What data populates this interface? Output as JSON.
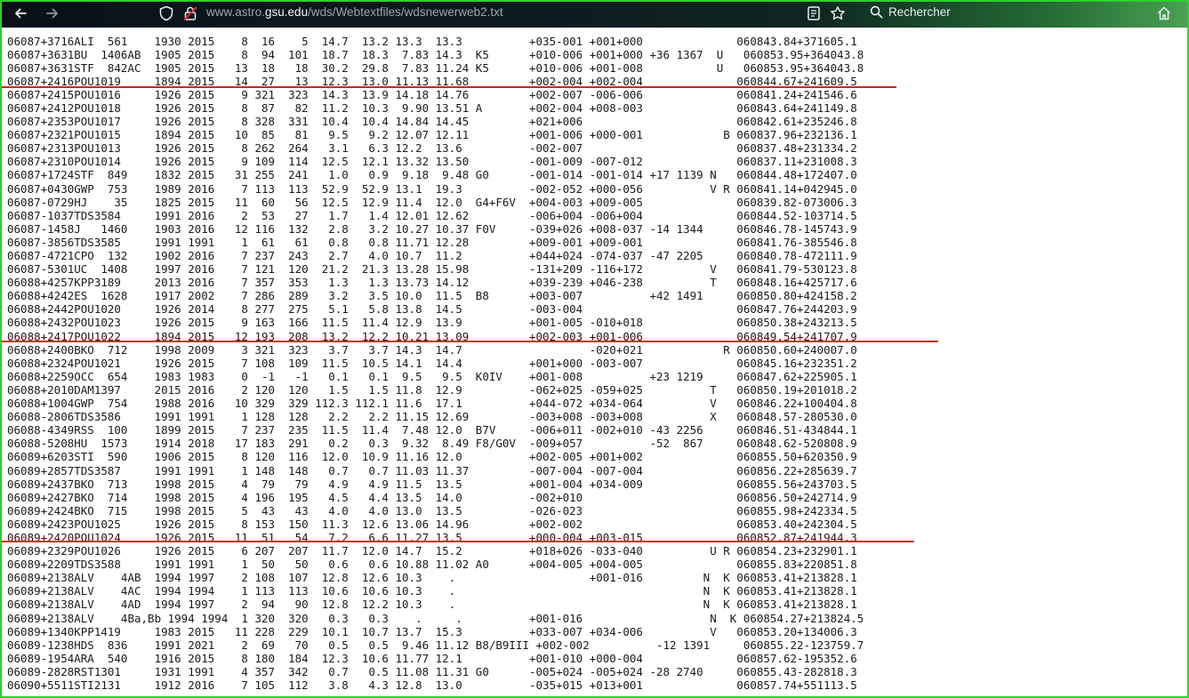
{
  "browser": {
    "url_prefix": "www.astro.",
    "url_host": "gsu.edu",
    "url_path": "/wds/Webtextfiles/wdsnewerweb2.txt",
    "search_label": "Rechercher",
    "accent_border": "#2fcf2f"
  },
  "icons": [
    "back-arrow-icon",
    "forward-arrow-icon",
    "shield-icon",
    "lock-icon",
    "reader-view-icon",
    "bookmark-star-icon",
    "search-icon",
    "home-icon"
  ],
  "separator_color": "#d62222",
  "lines": [
    "06087+3716ALI  561    1930 2015    8  16    5  14.7  13.2 13.3  13.3          +035-001 +001+000              060843.84+371605.1",
    "06087+3631BU  1406AB  1905 2015    8  94  101  18.7  18.3  7.83 14.3  K5      +010-006 +001+000 +36 1367  U   060853.95+364043.8",
    "06087+3631STF  842AC  1905 2015   13  18   18  30.2  29.8  7.83 11.24 K5      +010-006 +001-008           U   060853.95+364043.8",
    "06087+2416POU1019     1894 2015   14  27   13  12.3  13.0 11.13 11.68         +002-004 +002-004              060844.67+241609.5",
    "06087+2415POU1016     1926 2015    9 321  323  14.3  13.9 14.18 14.76         +002-007 -006-006              060841.24+241546.6",
    "06087+2412POU1018     1926 2015    8  87   82  11.2  10.3  9.90 13.51 A       +002-004 +008-003              060843.64+241149.8",
    "06087+2353POU1017     1926 2015    8 328  331  10.4  10.4 14.84 14.45         +021+006                       060842.61+235246.8",
    "06087+2321POU1015     1894 2015   10  85   81   9.5   9.2 12.07 12.11         +001-006 +000-001            B 060837.96+232136.1",
    "06087+2313POU1013     1926 2015    8 262  264   3.1   6.3 12.2  13.6          -002-007                       060837.48+231334.2",
    "06087+2310POU1014     1926 2015    9 109  114  12.5  12.1 13.32 13.50         -001-009 -007-012              060837.11+231008.3",
    "06087+1724STF  849    1832 2015   31 255  241   1.0   0.9  9.18  9.48 G0      -001-014 -001-014 +17 1139 N   060844.48+172407.0",
    "06087+0430GWP  753    1989 2016    7 113  113  52.9  52.9 13.1  19.3          -002-052 +000-056          V R 060841.14+042945.0",
    "06087-0729HJ    35    1825 2015   11  60   56  12.5  12.9 11.4  12.0  G4+F6V  +004-003 +009-005              060839.82-073006.3",
    "06087-1037TDS3584     1991 2016    2  53   27   1.7   1.4 12.01 12.62         -006+004 -006+004              060844.52-103714.5",
    "06087-1458J   1460    1903 2016   12 116  132   2.8   3.2 10.27 10.37 F0V     -039+026 +008-037 -14 1344     060846.78-145743.9",
    "06087-3856TDS3585     1991 1991    1  61   61   0.8   0.8 11.71 12.28         +009-001 +009-001              060841.76-385546.8",
    "06087-4721CPO  132    1902 2016    7 237  243   2.7   4.0 10.7  11.2          +044+024 -074-037 -47 2205     060840.78-472111.9",
    "06087-5301UC  1408    1997 2016    7 121  120  21.2  21.3 13.28 15.98         -131+209 -116+172          V   060841.79-530123.8",
    "06088+4257KPP3189     2013 2016    7 357  353   1.3   1.3 13.73 14.12         +039-239 +046-238          T   060848.16+425717.6",
    "06088+4242ES  1628    1917 2002    7 286  289   3.2   3.5 10.0  11.5  B8      +003-007          +42 1491     060850.80+424158.2",
    "06088+2442POU1020     1926 2014    8 277  275   5.1   5.8 13.8  14.5          -003-004                       060847.76+244203.9",
    "06088+2432POU1023     1926 2015    9 163  166  11.5  11.4 12.9  13.9          +001-005 -010+018              060850.38+243213.5",
    "06088+2417POU1022     1894 2015   12 193  208  13.2  12.2 10.21 13.09         +002-003 +001-006              060849.54+241707.9",
    "06088+2400BKO  712    1998 2009    3 321  323   3.7   3.7 14.3  14.7                   -020+021            R 060850.60+240007.0",
    "06088+2324POU1021     1926 2015    7 108  109  11.5  10.5 14.1  14.4          +001+000 -003-007              060845.16+232351.2",
    "06088+2259OCC  654    1983 1983    0  -1   -1   0.1   0.1  9.5   9.5  K0IV    +001-008          +23 1219     060847.62+225905.1",
    "06088+2010DAM1397     2015 2016    2 120  120   1.5   1.5 11.8  12.9          -062+025 -059+025          T   060850.19+201018.2",
    "06088+1004GWP  754    1988 2016   10 329  329 112.3 112.1 11.6  17.1          +044-072 +034-064          V   060846.22+100404.8",
    "06088-2806TDS3586     1991 1991    1 128  128   2.2   2.2 11.15 12.69         -003+008 -003+008          X   060848.57-280530.0",
    "06088-4349RSS  100    1899 2015    7 237  235  11.5  11.4  7.48 12.0  B7V     -006+011 -002+010 -43 2256     060846.51-434844.1",
    "06088-5208HU  1573    1914 2018   17 183  291   0.2   0.3  9.32  8.49 F8/G0V  -009+057          -52  867     060848.62-520808.9",
    "06089+6203STI  590    1906 2015    8 120  116  12.0  10.9 11.16 12.0          +002-005 +001+002              060855.50+620350.9",
    "06089+2857TDS3587     1991 1991    1 148  148   0.7   0.7 11.03 11.37         -007-004 -007-004              060856.22+285639.7",
    "06089+2437BKO  713    1998 2015    4  79   79   4.9   4.9 11.5  13.5          +001-004 +034-009              060855.56+243703.5",
    "06089+2427BKO  714    1998 2015    4 196  195   4.5   4.4 13.5  14.0          -002+010                       060856.50+242714.9",
    "06089+2424BKO  715    1998 2015    5  43   43   4.0   4.0 13.0  13.5          -026-023                       060855.98+242334.5",
    "06089+2423POU1025     1926 2015    8 153  150  11.3  12.6 13.06 14.96         +002-002                       060853.40+242304.5",
    "06089+2420POU1024     1926 2015   11  51   54   7.2   6.6 11.27 13.5          +000-004 +003-015              060852.87+241944.3",
    "06089+2329POU1026     1926 2015    6 207  207  11.7  12.0 14.7  15.2          +018+026 -033-040          U R 060854.23+232901.1",
    "06089+2209TDS3588     1991 1991    1  50   50   0.6   0.6 10.88 11.02 A0      +004-005 +004-005              060855.83+220851.8",
    "06089+2138ALV    4AB  1994 1997    2 108  107  12.8  12.6 10.3    .                    +001-016         N  K 060853.41+213828.1",
    "06089+2138ALV    4AC  1994 1994    1 113  113  10.6  10.6 10.3    .                                     N  K 060853.41+213828.1",
    "06089+2138ALV    4AD  1994 1997    2  94   90  12.8  12.2 10.3    .                                     N  K 060853.41+213828.1",
    "06089+2138ALV    4Ba,Bb 1994 1994  1 320  320   0.3   0.3    .     .          +001-016                   N  K 060854.27+213824.5",
    "06089+1340KPP1419     1983 2015   11 228  229  10.1  10.7 13.7  15.3          +033-007 +034-006          V   060853.20+134006.3",
    "06089-1238HDS  836    1991 2021    2  69   70   0.5   0.5  9.46 11.12 B8/B9III +002-002          -12 1391     060855.22-123759.7",
    "06089-1954ARA  540    1916 2015    8 180  184  12.3  10.6 11.77 12.1          +001-010 +000-004              060857.62-195352.6",
    "06089-2828RST1301     1931 1991    4 357  342   0.7   0.5 11.08 11.31 G0      -005+024 -005+024 -28 2740     060855.43-282818.3",
    "06090+5511STI2131     1912 2016    7 105  112   3.8   4.3 12.8  13.0          -035+015 +013+001              060857.74+551113.5"
  ]
}
